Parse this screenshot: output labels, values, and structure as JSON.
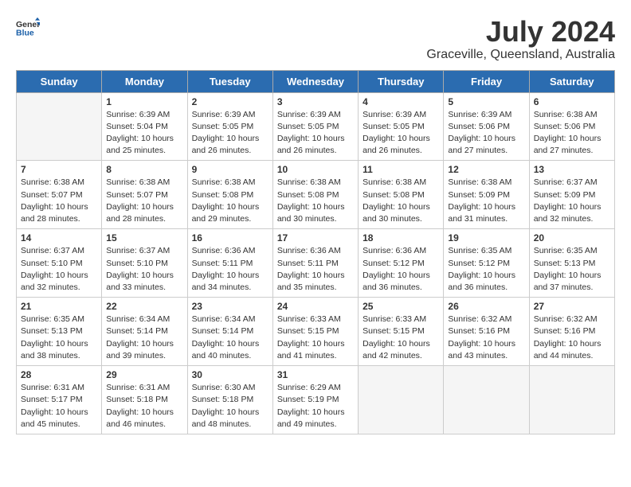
{
  "header": {
    "logo_general": "General",
    "logo_blue": "Blue",
    "month_year": "July 2024",
    "location": "Graceville, Queensland, Australia"
  },
  "days_of_week": [
    "Sunday",
    "Monday",
    "Tuesday",
    "Wednesday",
    "Thursday",
    "Friday",
    "Saturday"
  ],
  "weeks": [
    [
      {
        "day": "",
        "info": ""
      },
      {
        "day": "1",
        "info": "Sunrise: 6:39 AM\nSunset: 5:04 PM\nDaylight: 10 hours\nand 25 minutes."
      },
      {
        "day": "2",
        "info": "Sunrise: 6:39 AM\nSunset: 5:05 PM\nDaylight: 10 hours\nand 26 minutes."
      },
      {
        "day": "3",
        "info": "Sunrise: 6:39 AM\nSunset: 5:05 PM\nDaylight: 10 hours\nand 26 minutes."
      },
      {
        "day": "4",
        "info": "Sunrise: 6:39 AM\nSunset: 5:05 PM\nDaylight: 10 hours\nand 26 minutes."
      },
      {
        "day": "5",
        "info": "Sunrise: 6:39 AM\nSunset: 5:06 PM\nDaylight: 10 hours\nand 27 minutes."
      },
      {
        "day": "6",
        "info": "Sunrise: 6:38 AM\nSunset: 5:06 PM\nDaylight: 10 hours\nand 27 minutes."
      }
    ],
    [
      {
        "day": "7",
        "info": "Sunrise: 6:38 AM\nSunset: 5:07 PM\nDaylight: 10 hours\nand 28 minutes."
      },
      {
        "day": "8",
        "info": "Sunrise: 6:38 AM\nSunset: 5:07 PM\nDaylight: 10 hours\nand 28 minutes."
      },
      {
        "day": "9",
        "info": "Sunrise: 6:38 AM\nSunset: 5:08 PM\nDaylight: 10 hours\nand 29 minutes."
      },
      {
        "day": "10",
        "info": "Sunrise: 6:38 AM\nSunset: 5:08 PM\nDaylight: 10 hours\nand 30 minutes."
      },
      {
        "day": "11",
        "info": "Sunrise: 6:38 AM\nSunset: 5:08 PM\nDaylight: 10 hours\nand 30 minutes."
      },
      {
        "day": "12",
        "info": "Sunrise: 6:38 AM\nSunset: 5:09 PM\nDaylight: 10 hours\nand 31 minutes."
      },
      {
        "day": "13",
        "info": "Sunrise: 6:37 AM\nSunset: 5:09 PM\nDaylight: 10 hours\nand 32 minutes."
      }
    ],
    [
      {
        "day": "14",
        "info": "Sunrise: 6:37 AM\nSunset: 5:10 PM\nDaylight: 10 hours\nand 32 minutes."
      },
      {
        "day": "15",
        "info": "Sunrise: 6:37 AM\nSunset: 5:10 PM\nDaylight: 10 hours\nand 33 minutes."
      },
      {
        "day": "16",
        "info": "Sunrise: 6:36 AM\nSunset: 5:11 PM\nDaylight: 10 hours\nand 34 minutes."
      },
      {
        "day": "17",
        "info": "Sunrise: 6:36 AM\nSunset: 5:11 PM\nDaylight: 10 hours\nand 35 minutes."
      },
      {
        "day": "18",
        "info": "Sunrise: 6:36 AM\nSunset: 5:12 PM\nDaylight: 10 hours\nand 36 minutes."
      },
      {
        "day": "19",
        "info": "Sunrise: 6:35 AM\nSunset: 5:12 PM\nDaylight: 10 hours\nand 36 minutes."
      },
      {
        "day": "20",
        "info": "Sunrise: 6:35 AM\nSunset: 5:13 PM\nDaylight: 10 hours\nand 37 minutes."
      }
    ],
    [
      {
        "day": "21",
        "info": "Sunrise: 6:35 AM\nSunset: 5:13 PM\nDaylight: 10 hours\nand 38 minutes."
      },
      {
        "day": "22",
        "info": "Sunrise: 6:34 AM\nSunset: 5:14 PM\nDaylight: 10 hours\nand 39 minutes."
      },
      {
        "day": "23",
        "info": "Sunrise: 6:34 AM\nSunset: 5:14 PM\nDaylight: 10 hours\nand 40 minutes."
      },
      {
        "day": "24",
        "info": "Sunrise: 6:33 AM\nSunset: 5:15 PM\nDaylight: 10 hours\nand 41 minutes."
      },
      {
        "day": "25",
        "info": "Sunrise: 6:33 AM\nSunset: 5:15 PM\nDaylight: 10 hours\nand 42 minutes."
      },
      {
        "day": "26",
        "info": "Sunrise: 6:32 AM\nSunset: 5:16 PM\nDaylight: 10 hours\nand 43 minutes."
      },
      {
        "day": "27",
        "info": "Sunrise: 6:32 AM\nSunset: 5:16 PM\nDaylight: 10 hours\nand 44 minutes."
      }
    ],
    [
      {
        "day": "28",
        "info": "Sunrise: 6:31 AM\nSunset: 5:17 PM\nDaylight: 10 hours\nand 45 minutes."
      },
      {
        "day": "29",
        "info": "Sunrise: 6:31 AM\nSunset: 5:18 PM\nDaylight: 10 hours\nand 46 minutes."
      },
      {
        "day": "30",
        "info": "Sunrise: 6:30 AM\nSunset: 5:18 PM\nDaylight: 10 hours\nand 48 minutes."
      },
      {
        "day": "31",
        "info": "Sunrise: 6:29 AM\nSunset: 5:19 PM\nDaylight: 10 hours\nand 49 minutes."
      },
      {
        "day": "",
        "info": ""
      },
      {
        "day": "",
        "info": ""
      },
      {
        "day": "",
        "info": ""
      }
    ]
  ]
}
